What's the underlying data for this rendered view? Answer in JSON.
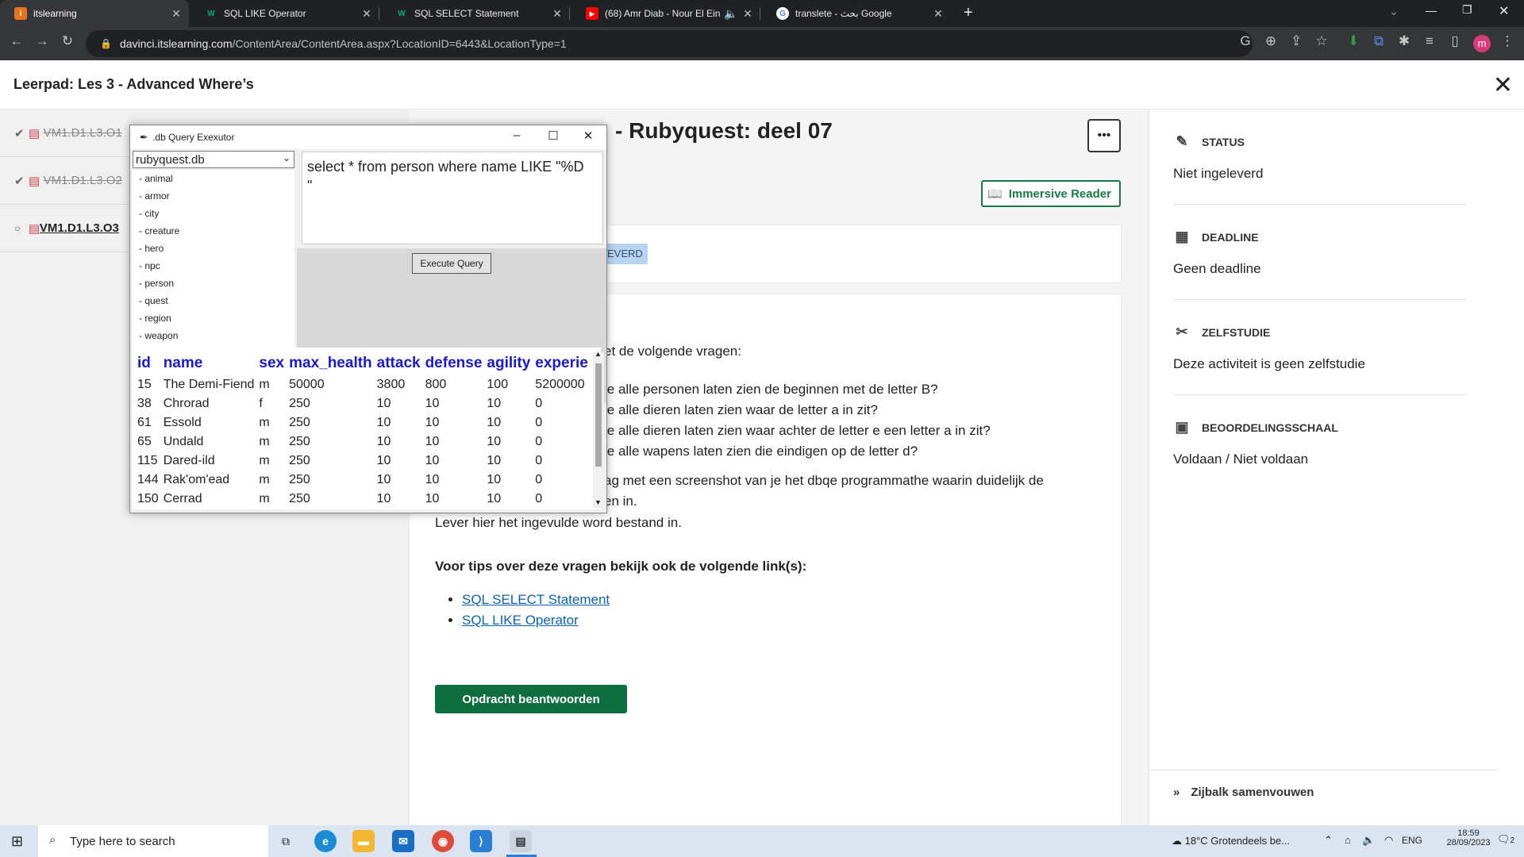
{
  "browser": {
    "tabs": [
      {
        "title": "itslearning",
        "favicon": "its-icon",
        "active": true
      },
      {
        "title": "SQL LIKE Operator",
        "favicon": "w3schools-icon",
        "active": false
      },
      {
        "title": "SQL SELECT Statement",
        "favicon": "w3schools-icon",
        "active": false
      },
      {
        "title": "(68) Amr Diab - Nour El Ein",
        "favicon": "youtube-icon",
        "active": false
      },
      {
        "title": "translete - بحث Google",
        "favicon": "google-icon",
        "active": false
      }
    ],
    "url_domain": "davinci.itslearning.com",
    "url_path": "/ContentArea/ContentArea.aspx?LocationID=6443&LocationType=1",
    "profile_initial": "m"
  },
  "lms": {
    "title": "Leerpad: Les 3 - Advanced Where’s",
    "left_items": [
      "VM1.D1.L3.O1",
      "VM1.D1.L3.O2",
      "VM1.D1.L3.O3"
    ],
    "assignment_title": "Rubyquest: deel 07",
    "more_label": "•••",
    "immersive_reader": "Immersive Reader",
    "status_badge": "EVERD",
    "intro_fragment": "et de volgende vragen:",
    "questions": [
      "je alle personen laten zien de beginnen met de letter B?",
      "je alle dieren laten zien waar de letter a in zit?",
      "je alle dieren laten zien waar achter de letter e een letter a in zit?",
      "je alle wapens laten zien die eindigen op de letter d?"
    ],
    "instruction_line1": "ag met een screenshot van je het dbqe programmathe waarin duidelijk de",
    "instruction_line2": "en in.",
    "submit_text": "Lever hier het ingevulde word bestand in.",
    "tips_heading": "Voor tips over deze vragen bekijk ook de volgende link(s):",
    "links": [
      "SQL SELECT Statement",
      "SQL LIKE Operator"
    ],
    "answer_button": "Opdracht beantwoorden"
  },
  "sidebar": {
    "sections": [
      {
        "label": "STATUS",
        "value": "Niet ingeleverd",
        "icon": "pencil-icon"
      },
      {
        "label": "DEADLINE",
        "value": "Geen deadline",
        "icon": "calendar-icon"
      },
      {
        "label": "ZELFSTUDIE",
        "value": "Deze activiteit is geen zelfstudie",
        "icon": "self-study-icon"
      },
      {
        "label": "BEOORDELINGSSCHAAL",
        "value": "Voldaan / Niet voldaan",
        "icon": "grade-scale-icon"
      }
    ],
    "collapse_label": "Zijbalk samenvouwen"
  },
  "query_window": {
    "title": ".db Query Exexutor",
    "database": "rubyquest.db",
    "tables": [
      "- animal",
      "- armor",
      "- city",
      "- creature",
      "- hero",
      "- npc",
      "- person",
      "- quest",
      "- region",
      "- weapon"
    ],
    "query_line1": "select * from person where name LIKE \"%D",
    "query_line2": "\"",
    "execute_label": "Execute Query",
    "columns": [
      "id",
      "name",
      "sex",
      "max_health",
      "attack",
      "defense",
      "agility",
      "experie"
    ],
    "rows": [
      [
        "15",
        "The Demi-Fiend",
        "m",
        "50000",
        "3800",
        "800",
        "100",
        "5200000"
      ],
      [
        "38",
        "Chrorad",
        "f",
        "250",
        "10",
        "10",
        "10",
        "0"
      ],
      [
        "61",
        "Essold",
        "m",
        "250",
        "10",
        "10",
        "10",
        "0"
      ],
      [
        "65",
        "Undald",
        "m",
        "250",
        "10",
        "10",
        "10",
        "0"
      ],
      [
        "115",
        "Dared-ild",
        "m",
        "250",
        "10",
        "10",
        "10",
        "0"
      ],
      [
        "144",
        "Rak'om'ead",
        "m",
        "250",
        "10",
        "10",
        "10",
        "0"
      ],
      [
        "150",
        "Cerrad",
        "m",
        "250",
        "10",
        "10",
        "10",
        "0"
      ]
    ]
  },
  "taskbar": {
    "search_placeholder": "Type here to search",
    "weather": "18°C  Grotendeels be...",
    "lang": "ENG",
    "time": "18:59",
    "date": "28/09/2023",
    "notifications": "2"
  }
}
